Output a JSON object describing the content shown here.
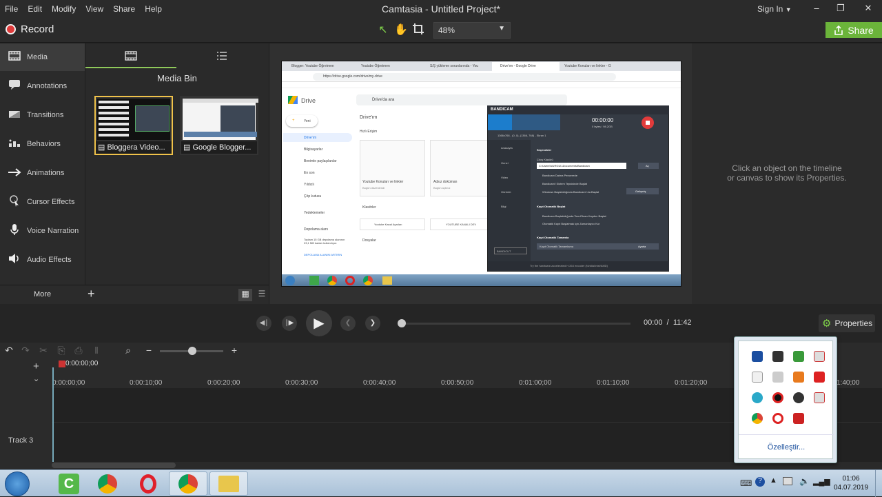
{
  "window": {
    "title": "Camtasia - Untitled Project*",
    "menu": [
      "File",
      "Edit",
      "Modify",
      "View",
      "Share",
      "Help"
    ],
    "sign_in": "Sign In",
    "controls": {
      "minimize": "–",
      "maximize": "❐",
      "close": "✕"
    }
  },
  "toolbar": {
    "record_label": "Record",
    "zoom_value": "48%",
    "share_label": "Share"
  },
  "sidebar": {
    "items": [
      {
        "label": "Media",
        "icon": "film-strip-icon"
      },
      {
        "label": "Annotations",
        "icon": "speech-bubble-icon"
      },
      {
        "label": "Transitions",
        "icon": "transition-icon"
      },
      {
        "label": "Behaviors",
        "icon": "behaviors-icon"
      },
      {
        "label": "Animations",
        "icon": "arrow-icon"
      },
      {
        "label": "Cursor Effects",
        "icon": "cursor-icon"
      },
      {
        "label": "Voice Narration",
        "icon": "microphone-icon"
      },
      {
        "label": "Audio Effects",
        "icon": "speaker-icon"
      }
    ],
    "more_label": "More"
  },
  "media_bin": {
    "title": "Media Bin",
    "items": [
      {
        "label": "Bloggera Video..."
      },
      {
        "label": "Google Blogger..."
      }
    ]
  },
  "properties": {
    "message_line1": "Click an object on the timeline",
    "message_line2": "or canvas to show its Properties.",
    "button_label": "Properties"
  },
  "playback": {
    "current_time": "00:00",
    "separator": "/",
    "total_time": "11:42",
    "progress": 0
  },
  "timeline": {
    "playhead_time": "0:00:00;00",
    "ticks": [
      "0:00:00;00",
      "0:00:10;00",
      "0:00:20;00",
      "0:00:30;00",
      "0:00:40;00",
      "0:00:50;00",
      "0:01:00;00",
      "0:01:10;00",
      "0:01:20;00",
      "1:40;00"
    ],
    "track_label": "Track 3"
  },
  "tray_popup": {
    "customize_label": "Özelleştir..."
  },
  "taskbar": {
    "time": "01:06",
    "date": "04.07.2019"
  },
  "stage_screenshot": {
    "tabs": [
      "Blogger: Youtube Öğretmen",
      "Youtube Öğretmen",
      "S/Ş yükleme sorunlarında - You",
      "Drive'ım - Google Drive",
      "Youtube Konuları ve linkler - G"
    ],
    "url": "https://drive.google.com/drive/my-drive",
    "drive_label": "Drive",
    "search_placeholder": "Drive'da ara",
    "new_label": "Yeni",
    "drive_nav": [
      "Drive'ım",
      "Bilgisayarlar",
      "Benimle paylaşılanlar",
      "En son",
      "Yıldızlı",
      "Çöp kutusu",
      "Yedeklemeler",
      "Depolama alanı"
    ],
    "storage_text": "Toplam 15 GB depolama alanının 23,1 MB kadarı kullanılıyor.",
    "storage_link": "DEPOLAMA ALANINI ARTIRIN",
    "my_drive_heading": "Drive'ım",
    "quick_access": "Hızlı Erişim",
    "quick_files": [
      "Youtube Konuları ve linkler",
      "Adsız doküman"
    ],
    "quick_sub": [
      "Bugün düzenlendi",
      "Bugün açtınız"
    ],
    "folders_heading": "Klasörler",
    "folders": [
      "Youtube Kanal Ayarları",
      "YOUTUBE KANALI DEV"
    ],
    "files_heading": "Dosyalar",
    "bandicam": {
      "logo": "BANDICAM",
      "timer": "00:00:00",
      "size": "0 bytes / 98.2GB",
      "resolution": "1366x768 - (0, 0), (1366, 768) - Ekran 1",
      "side": [
        "Anasayfa",
        "Genel",
        "Video",
        "Görüntü",
        "Bilgi"
      ],
      "section1": "Seçenekler",
      "output_label": "Çıkış Klasörü",
      "output_path": "C:\\Users\\NURGÜL\\Documents\\Bandicam",
      "open_btn": "Aç",
      "opt1": "Bandicam Daima Pencerede",
      "opt2": "Bandicam'i Sistem Tepsisinde Başlat",
      "opt3": "Windows Başlatıldığında Bandicam'i da Başlat",
      "settings_btn": "Gelişmiş",
      "section2": "Kayıt Otomatik Başlat",
      "opt4": "Bandicam Başlatıldığında Tam-Ekran Kaydını Başlat",
      "opt5": "Otomatik Kayıt Başlatmak için Zamanlayıcı Kur",
      "section3": "Kayıt Otomatik Tamamla",
      "auto_value": "Kayıt Otomatik Tamamlama",
      "settings_btn2": "Ayarla",
      "footer": "Try the hardware-accelerated H.264 encoder (Nvidia/Intel/AMD)",
      "bandicut": "BANDICUT"
    }
  },
  "colors": {
    "accent_green": "#6bb43a",
    "record_red": "#e03b3b",
    "selection_yellow": "#f0c24a",
    "bandicam_blue": "#1c7dcc"
  }
}
